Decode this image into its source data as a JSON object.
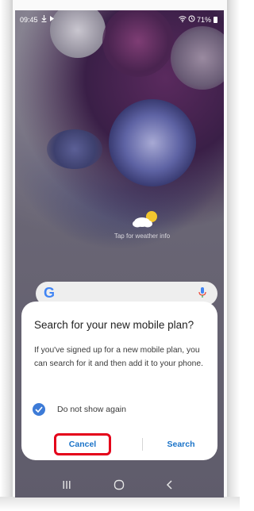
{
  "status_bar": {
    "time": "09:45",
    "battery": "71%",
    "left_icons": [
      "download-icon",
      "play-icon"
    ],
    "right_icons": [
      "wifi-icon",
      "alarm-icon",
      "battery-icon"
    ]
  },
  "home": {
    "weather_label": "Tap for weather info",
    "search_bar": {
      "logo": "G",
      "mic_icon": "mic-icon"
    }
  },
  "dialog": {
    "title": "Search for your new mobile plan?",
    "body": "If you've signed up for a new mobile plan, you can search for it and then add it to your phone.",
    "checkbox_label": "Do not show again",
    "checkbox_checked": true,
    "cancel_label": "Cancel",
    "search_label": "Search",
    "highlight_color": "#e4001a",
    "button_color": "#1a73c8"
  },
  "nav_bar": {
    "items": [
      "recent-apps-icon",
      "home-icon",
      "back-icon"
    ]
  }
}
